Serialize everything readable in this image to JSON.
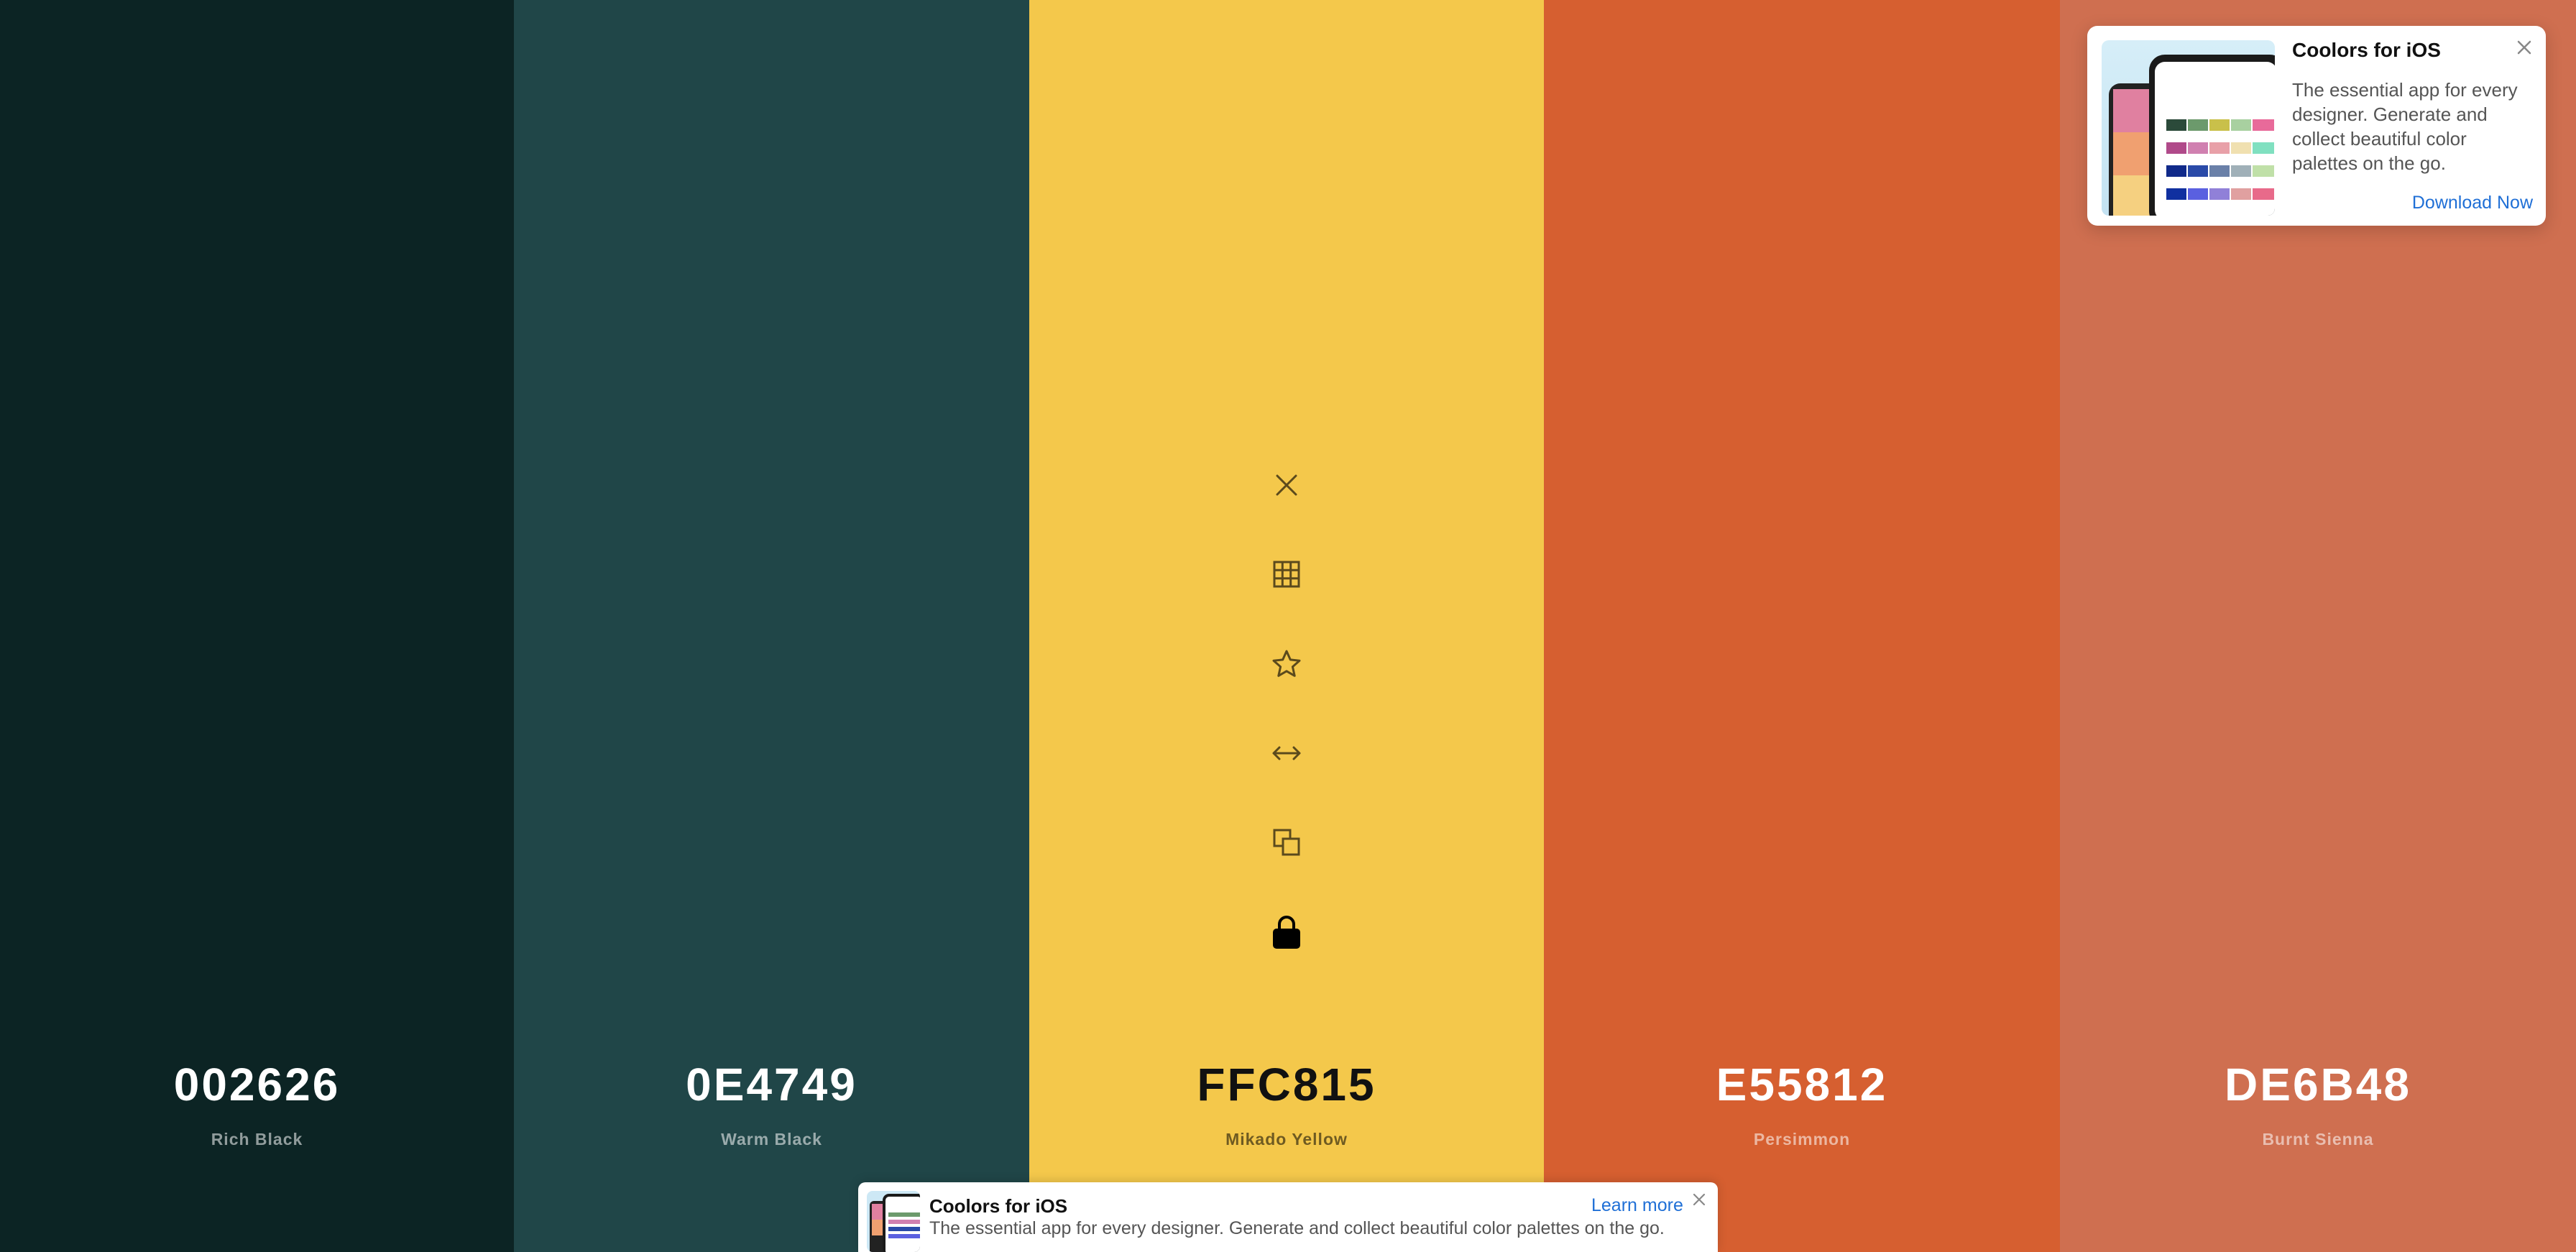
{
  "swatches": [
    {
      "hex": "002626",
      "name": "Rich Black",
      "bg": "#0c2424"
    },
    {
      "hex": "0E4749",
      "name": "Warm Black",
      "bg": "#204648"
    },
    {
      "hex": "FFC815",
      "name": "Mikado Yellow",
      "bg": "#f4c84b"
    },
    {
      "hex": "E55812",
      "name": "Persimmon",
      "bg": "#d65f30"
    },
    {
      "hex": "DE6B48",
      "name": "Burnt Sienna",
      "bg": "#cf6f50"
    }
  ],
  "tools": [
    {
      "icon": "close-icon",
      "action": "Remove color"
    },
    {
      "icon": "grid-icon",
      "action": "View shades"
    },
    {
      "icon": "star-icon",
      "action": "Save color"
    },
    {
      "icon": "drag-arrows-icon",
      "action": "Drag"
    },
    {
      "icon": "copy-icon",
      "action": "Copy hex"
    },
    {
      "icon": "lock-icon",
      "action": "Toggle lock",
      "locked": true
    }
  ],
  "promo": {
    "title": "Coolors for iOS",
    "description": "The essential app for every designer. Generate and collect beautiful color palettes on the go.",
    "cta": "Download Now"
  },
  "banner": {
    "title": "Coolors for iOS",
    "description": "The essential app for every designer. Generate and collect beautiful color palettes on the go.",
    "cta": "Learn more"
  },
  "colors": {
    "link": "#1f6fd6",
    "tool_icon": "#5b4a1c",
    "lock_icon": "#000000"
  }
}
